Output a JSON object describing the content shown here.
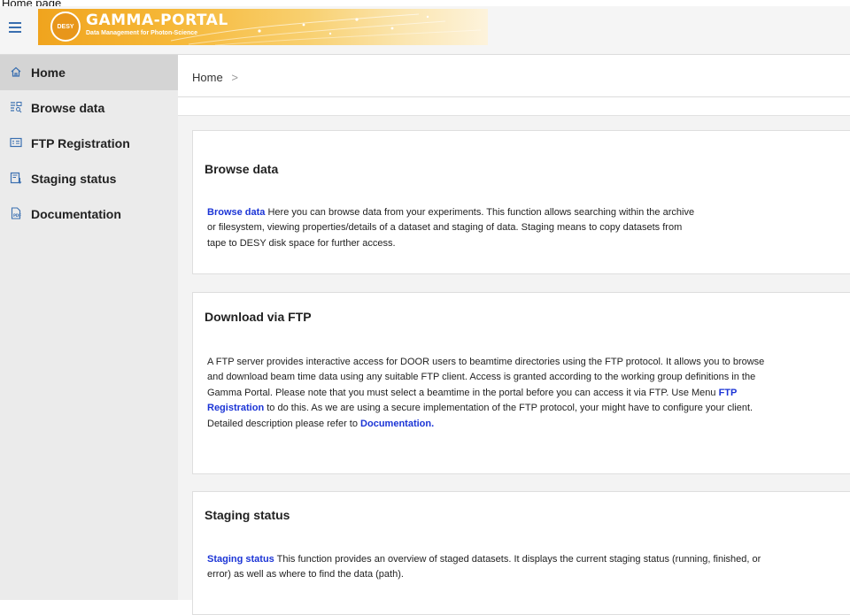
{
  "window": {
    "caption": "Home page"
  },
  "header": {
    "brand_title": "GAMMA-PORTAL",
    "brand_subtitle": "Data Management for Photon-Science",
    "logo_text": "DESY"
  },
  "sidebar": {
    "items": [
      {
        "label": "Home",
        "icon": "home-icon",
        "active": true
      },
      {
        "label": "Browse data",
        "icon": "browse-icon",
        "active": false
      },
      {
        "label": "FTP Registration",
        "icon": "id-card-icon",
        "active": false
      },
      {
        "label": "Staging status",
        "icon": "staging-icon",
        "active": false
      },
      {
        "label": "Documentation",
        "icon": "pdf-icon",
        "active": false
      }
    ]
  },
  "breadcrumb": {
    "label": "Home",
    "separator": ">"
  },
  "cards": {
    "browse": {
      "title": "Browse data",
      "link": "Browse data",
      "text": " Here you can browse data from your experiments. This function allows searching within the archive or filesystem, viewing properties/details of a dataset and staging of data. Staging means to copy datasets from tape to DESY disk space for further access."
    },
    "ftp": {
      "title": "Download via FTP",
      "text1": "A FTP server provides interactive access for DOOR users to beamtime directories using the FTP protocol. It allows you to browse and download beam time data using any suitable FTP client. Access is granted according to the working group definitions in the Gamma Portal. Please note that you must select a beamtime in the portal before you can access it via FTP. Use Menu ",
      "link1": "FTP Registration",
      "text2": " to do this. As we are using a secure implementation of the FTP protocol, your might have to configure your client. Detailed description please refer to ",
      "link2": "Documentation."
    },
    "staging": {
      "title": "Staging status",
      "link": "Staging status",
      "text": " This function provides an overview of staged datasets. It displays the current staging status (running, finished, or error) as well as where to find the data (path)."
    }
  },
  "colors": {
    "accent": "#3a6fb0",
    "link": "#1b34d6",
    "banner": "#f0a41e"
  }
}
